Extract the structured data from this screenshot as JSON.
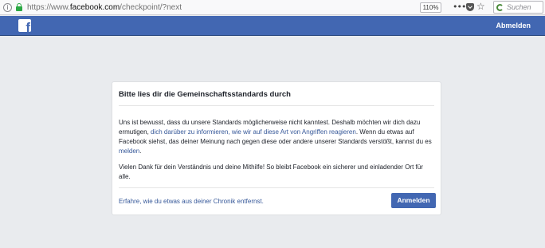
{
  "browser": {
    "url_prefix": "https://www.",
    "url_host": "facebook.com",
    "url_path": "/checkpoint/?next",
    "zoom": "110%",
    "search_placeholder": "Suchen",
    "icons": {
      "info": "info-icon",
      "lock": "lock-icon",
      "menu": "dots-icon",
      "pocket": "pocket-icon",
      "bookmark": "star-icon",
      "search_engine": "google-icon"
    }
  },
  "header": {
    "logo_letter": "f",
    "logout_label": "Abmelden",
    "brand_color": "#4267b2"
  },
  "dialog": {
    "title": "Bitte lies dir die Gemeinschaftsstandards durch",
    "paragraph1_text1": "Uns ist bewusst, dass du unsere Standards möglicherweise nicht kanntest. Deshalb möchten wir dich dazu ermutigen, ",
    "paragraph1_link1": "dich darüber zu informieren, wie wir auf diese Art von Angriffen reagieren",
    "paragraph1_text2": ". Wenn du etwas auf Facebook siehst, das deiner Meinung nach gegen diese oder andere unserer Standards verstößt, kannst du es ",
    "paragraph1_link2": "melden",
    "paragraph1_text3": ".",
    "paragraph2": "Vielen Dank für dein Verständnis und deine Mithilfe! So bleibt Facebook ein sicherer und einladender Ort für alle.",
    "chronicle_link": "Erfahre, wie du etwas aus deiner Chronik entfernst.",
    "login_button": "Anmelden",
    "link_color": "#365899"
  }
}
